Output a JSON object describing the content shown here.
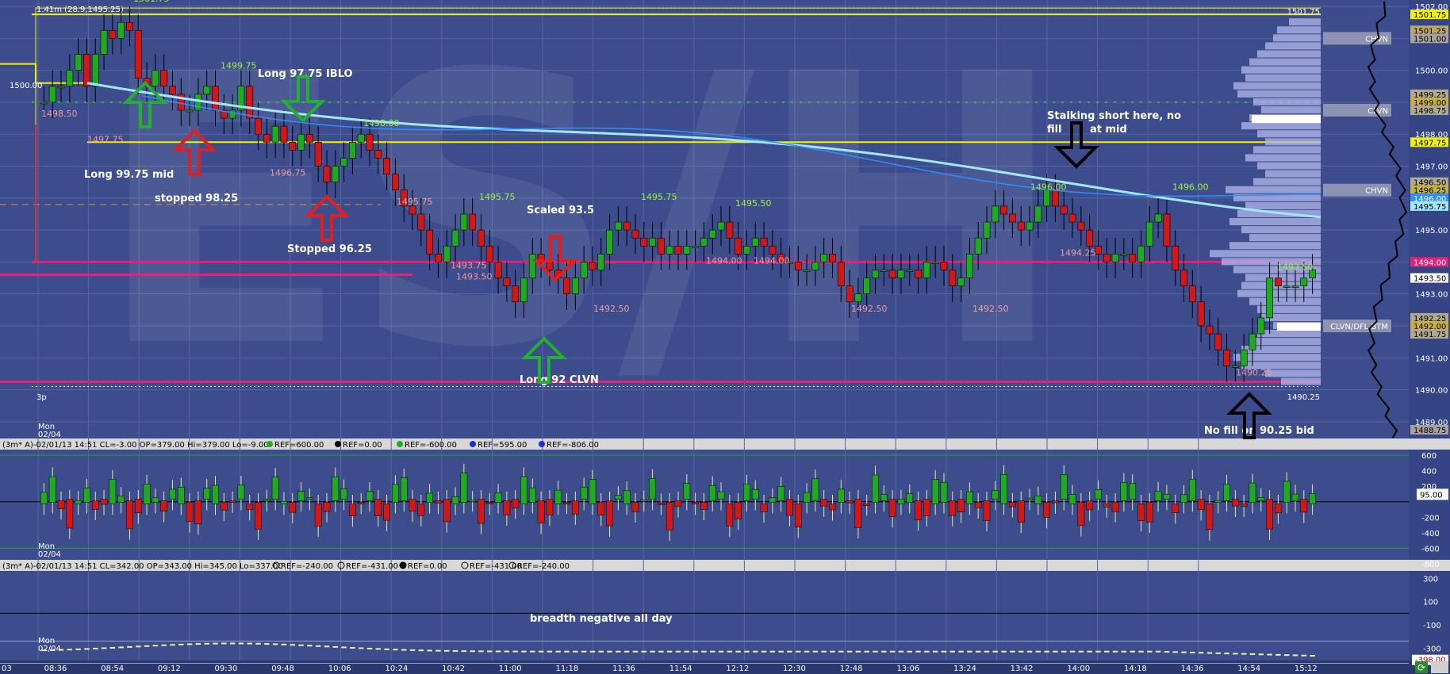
{
  "colors": {
    "bg": "#3c4c8c",
    "grid": "#5664a0",
    "up": "#1faa22",
    "down": "#d01818",
    "yellow": "#f2f200",
    "magenta": "#e8207a",
    "vwap_light": "#9fe8ff",
    "vwap_blue": "#2f8fff",
    "profile": "#b4b8ee",
    "hi_label": "#a0f040",
    "lo_label": "#f09aa0",
    "axis_bg": "#344484",
    "axis_text": "#ffffff",
    "annotation": "#ffffff"
  },
  "watermark": "ES/H",
  "main_panel": {
    "top_left_info": "1.41m (28.9,1495.25)",
    "open_price_tag": "1500.00",
    "time_start_label": "3p",
    "date_label": "Mon 02/04",
    "right_edge_labels": {
      "top": "1501.75",
      "bottom": "1490.25"
    },
    "price_tags": [
      {
        "text": "1498.50",
        "color": "lo"
      },
      {
        "text": "1497.75",
        "color": "lo"
      },
      {
        "text": "1496.75",
        "color": "lo"
      },
      {
        "text": "1495.75",
        "color": "lo"
      },
      {
        "text": "1493.75",
        "color": "lo"
      },
      {
        "text": "1493.50",
        "color": "lo"
      },
      {
        "text": "1492.50",
        "color": "lo"
      },
      {
        "text": "1494.00",
        "color": "lo"
      },
      {
        "text": "1494.00",
        "color": "lo"
      },
      {
        "text": "1492.50",
        "color": "lo"
      },
      {
        "text": "1492.50",
        "color": "lo"
      },
      {
        "text": "1494.25",
        "color": "lo"
      },
      {
        "text": "1490.25",
        "color": "lo"
      },
      {
        "text": "1501.75",
        "color": "hi"
      },
      {
        "text": "1499.75",
        "color": "hi"
      },
      {
        "text": "1498.00",
        "color": "hi"
      },
      {
        "text": "1495.75",
        "color": "hi"
      },
      {
        "text": "1495.75",
        "color": "hi"
      },
      {
        "text": "1495.50",
        "color": "hi"
      },
      {
        "text": "1496.00",
        "color": "hi"
      },
      {
        "text": "1496.00",
        "color": "hi"
      },
      {
        "text": "1493.50",
        "color": "hi"
      }
    ],
    "annotations": [
      "Long 99.75 mid",
      "stopped 98.25",
      "Long 97.75 IBLO",
      "Stopped 96.25",
      "Scaled 93.5",
      "Long 92 CLVN",
      "Stalking short here, no",
      "fill",
      "at mid",
      "No fill on 90.25 bid"
    ],
    "profile_labels": [
      "CHVN",
      "CLVN",
      "CHVN",
      "CLVN/DFL BTM"
    ],
    "axis": {
      "ticks": [
        "1502.00",
        "1501.00",
        "1500.00",
        "1499.00",
        "1498.00",
        "1497.00",
        "1496.00",
        "1495.00",
        "1494.00",
        "1493.00",
        "1492.00",
        "1491.00",
        "1490.00",
        "1489.00"
      ],
      "tags": [
        {
          "text": "1501.75",
          "bg": "#f2f200",
          "fg": "#000000"
        },
        {
          "text": "1501.25",
          "bg": "#b8a868",
          "fg": "#000000"
        },
        {
          "text": "1501.00",
          "bg": "#a8a0a0",
          "fg": "#000000"
        },
        {
          "text": "1499.25",
          "bg": "#b0a890",
          "fg": "#000000"
        },
        {
          "text": "1499.00",
          "bg": "#c8b040",
          "fg": "#000000"
        },
        {
          "text": "1498.75",
          "bg": "#b0a890",
          "fg": "#000000"
        },
        {
          "text": "1497.75",
          "bg": "#f2f200",
          "fg": "#000000"
        },
        {
          "text": "1496.50",
          "bg": "#b0a890",
          "fg": "#000000"
        },
        {
          "text": "1496.25",
          "bg": "#c8b040",
          "fg": "#000000"
        },
        {
          "text": "1496.00",
          "bg": "#2f8fff",
          "fg": "#ffffff"
        },
        {
          "text": "1495.75",
          "bg": "#9fe8ff",
          "fg": "#000000"
        },
        {
          "text": "1494.00",
          "bg": "#e8207a",
          "fg": "#ffffff"
        },
        {
          "text": "1493.50",
          "bg": "#ffffff",
          "fg": "#000000"
        },
        {
          "text": "1492.25",
          "bg": "#b0a890",
          "fg": "#000000"
        },
        {
          "text": "1492.00",
          "bg": "#c8b040",
          "fg": "#000000"
        },
        {
          "text": "1491.75",
          "bg": "#b0a890",
          "fg": "#000000"
        },
        {
          "text": "1488.75",
          "bg": "#a8a0a0",
          "fg": "#000000"
        }
      ]
    }
  },
  "panel2": {
    "header": [
      "(3m* A)-02/01/13 14:51 CL=-3.00 OP=379.00 Hi=379.00 Lo=-9.00",
      "REF=600.00",
      "REF=0.00",
      "REF=-600.00",
      "REF=595.00",
      "REF=-806.00"
    ],
    "date_label": "Mon 02/04",
    "axis_ticks": [
      "600",
      "400",
      "200",
      "-200",
      "-400",
      "-600",
      "-800"
    ],
    "value_tag": "95.00"
  },
  "panel3": {
    "header": [
      "(3m* A)-02/01/13 14:51 CL=342.00 OP=343.00 Hi=345.00 Lo=337.00",
      "REF=-240.00",
      "REF=-431.00",
      "REF=0.00",
      "REF=-431.00",
      "REF=-240.00"
    ],
    "annotation": "breadth negative all day",
    "date_label": "Mon 02/04",
    "axis_ticks": [
      "300",
      "100",
      "-100",
      "-300"
    ],
    "value_tag": "-398.00"
  },
  "time_axis": {
    "labels": [
      "03",
      "08:36",
      "08:54",
      "09:12",
      "09:30",
      "09:48",
      "10:06",
      "10:24",
      "10:42",
      "11:00",
      "11:18",
      "11:36",
      "11:54",
      "12:12",
      "12:30",
      "12:48",
      "13:06",
      "13:24",
      "13:42",
      "14:00",
      "14:18",
      "14:36",
      "14:54",
      "15:12"
    ]
  },
  "chart_data": {
    "type": "candlestick",
    "instrument": "ES/H",
    "timeframe": "3m",
    "y_range": [
      1488.5,
      1502.2
    ],
    "x_time_labels": [
      "08:36",
      "08:54",
      "09:12",
      "09:30",
      "09:48",
      "10:06",
      "10:24",
      "10:42",
      "11:00",
      "11:18",
      "11:36",
      "11:54",
      "12:12",
      "12:30",
      "12:48",
      "13:06",
      "13:24",
      "13:42",
      "14:00",
      "14:18",
      "14:36",
      "14:54",
      "15:12"
    ],
    "closes": [
      1499,
      1499.5,
      1499.5,
      1500,
      1500.5,
      1499.5,
      1500.5,
      1501.25,
      1501,
      1501.5,
      1501.25,
      1499.75,
      1499.5,
      1500,
      1499.5,
      1499.25,
      1498.75,
      1498.75,
      1499.25,
      1499.5,
      1498.75,
      1498.5,
      1498.75,
      1499.5,
      1498.5,
      1498,
      1497.75,
      1498.25,
      1497.75,
      1497.5,
      1498,
      1497.75,
      1497,
      1496.5,
      1497,
      1497.25,
      1497.75,
      1498,
      1497.5,
      1497.25,
      1496.75,
      1496.25,
      1495.75,
      1495.5,
      1495,
      1494.25,
      1494,
      1494.5,
      1495,
      1495.5,
      1495,
      1494.5,
      1494,
      1493.5,
      1493.25,
      1492.75,
      1493.5,
      1494.25,
      1494,
      1493.75,
      1493.5,
      1493,
      1493.5,
      1494,
      1493.75,
      1494.25,
      1495,
      1495.25,
      1495,
      1494.75,
      1494.5,
      1494.75,
      1494.25,
      1494.5,
      1494.25,
      1494.5,
      1494.5,
      1494.75,
      1495,
      1495.25,
      1494.75,
      1494.25,
      1494.5,
      1494.75,
      1494.5,
      1494.25,
      1494,
      1494,
      1493.75,
      1493.75,
      1494,
      1494.25,
      1494,
      1493.25,
      1492.75,
      1493,
      1493.5,
      1493.75,
      1493.75,
      1493.5,
      1493.75,
      1493.75,
      1493.5,
      1494,
      1494,
      1493.75,
      1493.25,
      1493.5,
      1494.25,
      1494.75,
      1495.25,
      1495.75,
      1495.5,
      1495.25,
      1495,
      1495.25,
      1495.75,
      1496.25,
      1495.75,
      1495.5,
      1495.25,
      1495,
      1494.5,
      1494.25,
      1494,
      1494.25,
      1494.25,
      1494,
      1494.5,
      1495.25,
      1495.5,
      1494.5,
      1493.75,
      1493.25,
      1492.75,
      1492,
      1491.75,
      1491.25,
      1490.75,
      1490.75,
      1491.25,
      1491.75,
      1492.25,
      1493.5,
      1493.25,
      1493.25,
      1493.25,
      1493.5,
      1493.75
    ],
    "opens_offsets_note": "",
    "ohlc_source": "estimated"
  }
}
